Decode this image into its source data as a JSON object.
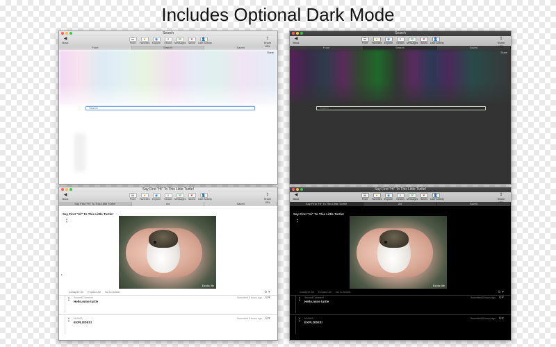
{
  "headline": "Includes Optional Dark Mode",
  "toolbar": {
    "back_label": "Back",
    "share_label": "Share URL",
    "buttons": [
      {
        "label": "Front",
        "icon": "front-icon"
      },
      {
        "label": "Favorites",
        "icon": "favorites-icon"
      },
      {
        "label": "Explore",
        "icon": "explore-icon"
      },
      {
        "label": "Search",
        "icon": "search-icon"
      },
      {
        "label": "Messages",
        "icon": "messages-icon"
      },
      {
        "label": "Saved",
        "icon": "saved-icon"
      },
      {
        "label": "User Activity",
        "icon": "user-icon"
      }
    ]
  },
  "search_window": {
    "title": "Search",
    "tabs": [
      "Front",
      "Search",
      "Saved"
    ],
    "selected_tab": "Search",
    "done_label": "Done",
    "search_placeholder": "Search"
  },
  "post_window": {
    "title": "Say First \"Hi\" To This Little Turtle!",
    "tabs": [
      "Say First \"Hi\" To This Little Turtle!",
      "Art",
      "Saved"
    ],
    "selected_tab": "Say First \"Hi\" To This Little Turtle!",
    "post_title": "Say First \"Hi\" To This Little Turtle!",
    "photo_credit": "Exotic life",
    "actions": {
      "collapse": "Collapse All",
      "expand": "Expand All",
      "go_to": "Go to Article"
    },
    "comments": [
      {
        "user": "SecondComment",
        "date": "Submitted 8 hours ago",
        "text": "Hello.mine turtle"
      },
      {
        "user": "MYNAS",
        "date": "Submitted 8 hours ago",
        "text": "EXPLODES!"
      }
    ]
  },
  "colors": {
    "light_bg": "#ffffff",
    "dark_bg": "#000000",
    "dark_search_bg": "#333333",
    "traffic_red": "#fc605b",
    "traffic_yellow": "#fdbc40",
    "traffic_green": "#34c84a",
    "search_focus": "#7aa7e0"
  }
}
